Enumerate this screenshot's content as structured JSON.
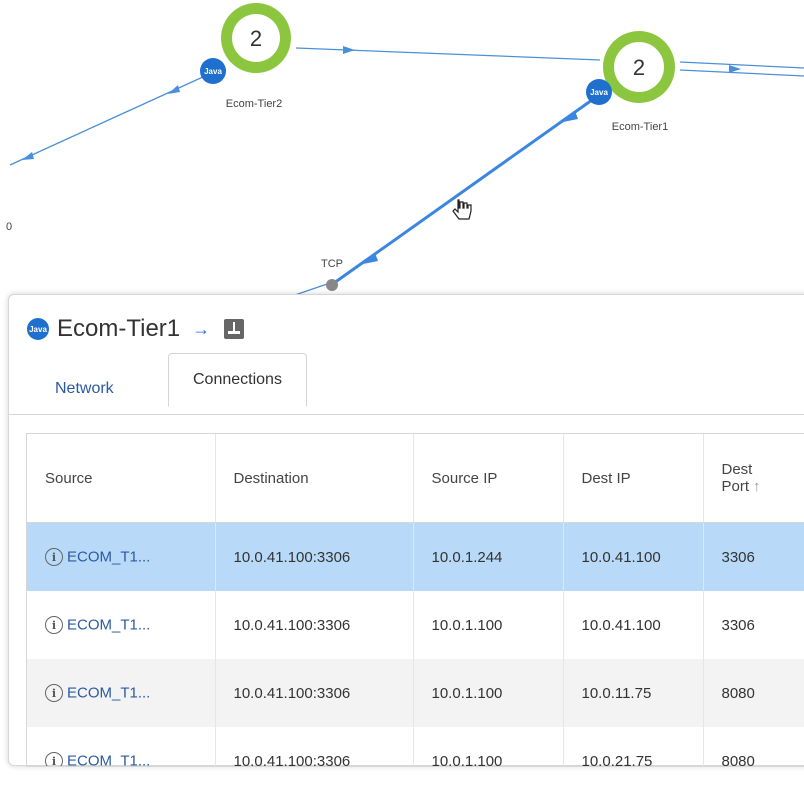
{
  "graph": {
    "nodes": [
      {
        "name": "Ecom-Tier2",
        "count": "2",
        "badge": "Java"
      },
      {
        "name": "Ecom-Tier1",
        "count": "2",
        "badge": "Java"
      }
    ],
    "edge_label": "TCP",
    "edge_partial_label": "0"
  },
  "panel": {
    "badge": "Java",
    "title": "Ecom-Tier1",
    "arrow_icon": "right-arrow-icon",
    "db_icon": "database-icon",
    "tabs": [
      {
        "label": "Network",
        "active": false
      },
      {
        "label": "Connections",
        "active": true
      }
    ],
    "table": {
      "columns": [
        "Source",
        "Destination",
        "Source IP",
        "Dest IP",
        "Dest\nPort"
      ],
      "sort_column": "Dest Port",
      "rows": [
        {
          "source": "ECOM_T1...",
          "destination": "10.0.41.100:3306",
          "source_ip": "10.0.1.244",
          "dest_ip": "10.0.41.100",
          "dest_port": "3306",
          "selected": true
        },
        {
          "source": "ECOM_T1...",
          "destination": "10.0.41.100:3306",
          "source_ip": "10.0.1.100",
          "dest_ip": "10.0.41.100",
          "dest_port": "3306",
          "selected": false
        },
        {
          "source": "ECOM_T1...",
          "destination": "10.0.41.100:3306",
          "source_ip": "10.0.1.100",
          "dest_ip": "10.0.11.75",
          "dest_port": "8080",
          "selected": false
        },
        {
          "source": "ECOM_T1...",
          "destination": "10.0.41.100:3306",
          "source_ip": "10.0.1.100",
          "dest_ip": "10.0.21.75",
          "dest_port": "8080",
          "selected": false
        }
      ]
    }
  },
  "colors": {
    "node_ring": "#8cc63f",
    "java_blue": "#1f6fcf",
    "edge_blue": "#4a90d9",
    "selected_row": "#b8daf8",
    "link": "#2c5aa0"
  }
}
